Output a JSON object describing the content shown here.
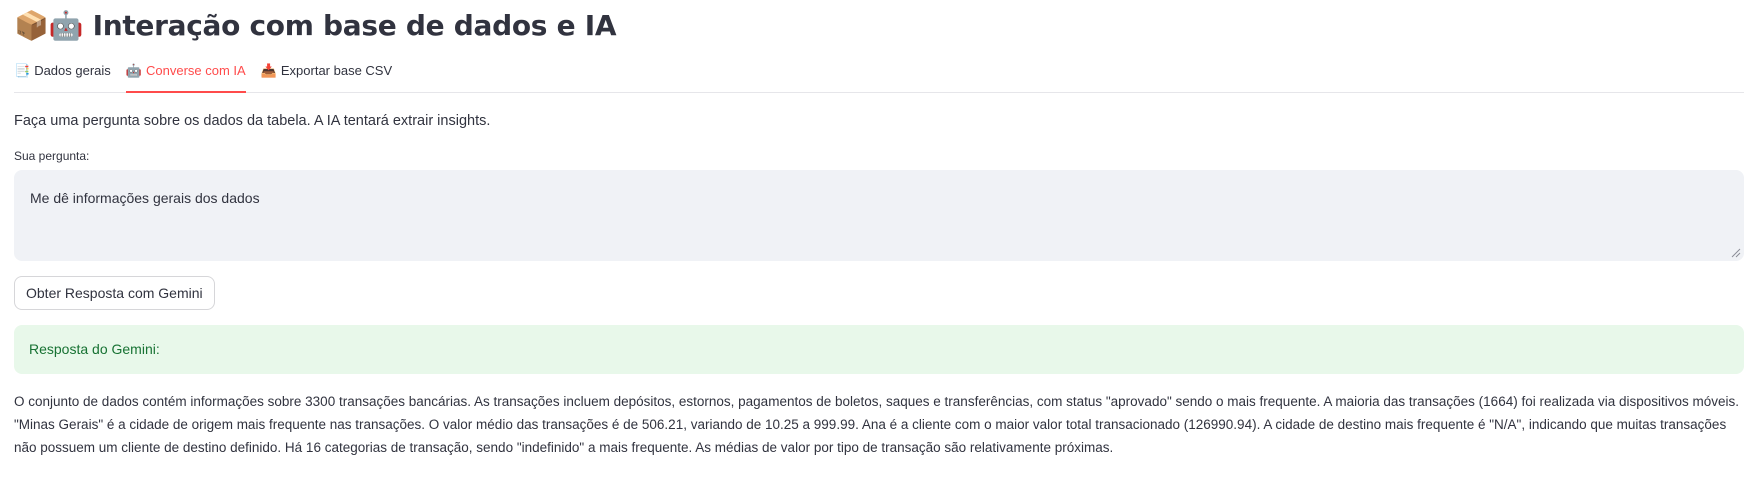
{
  "header": {
    "title_icons": "📦🤖",
    "title": "Interação com base de dados e IA"
  },
  "tabs": [
    {
      "icon": "📑",
      "label": "Dados gerais",
      "active": false
    },
    {
      "icon": "🤖",
      "label": "Converse com IA",
      "active": true
    },
    {
      "icon": "📥",
      "label": "Exportar base CSV",
      "active": false
    }
  ],
  "main": {
    "intro": "Faça uma pergunta sobre os dados da tabela. A IA tentará extrair insights.",
    "question_label": "Sua pergunta:",
    "question_value": "Me dê informações gerais dos dados",
    "submit_label": "Obter Resposta com Gemini",
    "response_heading": "Resposta do Gemini:",
    "response_text": "O conjunto de dados contém informações sobre 3300 transações bancárias. As transações incluem depósitos, estornos, pagamentos de boletos, saques e transferências, com status \"aprovado\" sendo o mais frequente. A maioria das transações (1664) foi realizada via dispositivos móveis. \"Minas Gerais\" é a cidade de origem mais frequente nas transações. O valor médio das transações é de 506.21, variando de 10.25 a 999.99. Ana é a cliente com o maior valor total transacionado (126990.94). A cidade de destino mais frequente é \"N/A\", indicando que muitas transações não possuem um cliente de destino definido. Há 16 categorias de transação, sendo \"indefinido\" a mais frequente. As médias de valor por tipo de transação são relativamente próximas."
  },
  "colors": {
    "accent": "#ff4b4b",
    "text": "#31333f",
    "input_bg": "#f0f2f6",
    "success_bg": "#e8f8ea",
    "success_text": "#177233"
  }
}
